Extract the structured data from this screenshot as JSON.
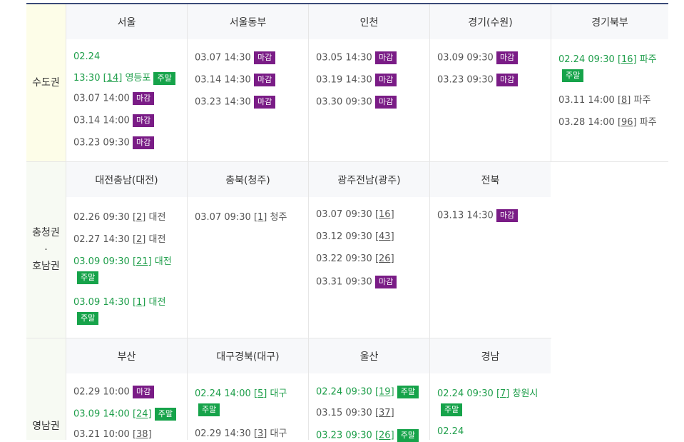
{
  "colors": {
    "closed_badge": "#7a1c86",
    "weekend_badge": "#16a34a",
    "green_text": "#1e9e4a",
    "top_line": "#3a4a78"
  },
  "regions": {
    "capital": {
      "label": "수도권",
      "cities": {
        "seoul": {
          "name": "서울"
        },
        "seoul_east": {
          "name": "서울동부"
        },
        "incheon": {
          "name": "인천"
        },
        "gyeonggi_suwon": {
          "name": "경기(수원)"
        },
        "gyeonggi_north": {
          "name": "경기북부"
        }
      }
    },
    "chungcheong_honam": {
      "label_top": "충청권",
      "label_dot": "·",
      "label_bottom": "호남권",
      "cities": {
        "daejeon": {
          "name": "대전충남(대전)"
        },
        "chungbuk": {
          "name": "충북(청주)"
        },
        "gwangju": {
          "name": "광주전남(광주)"
        },
        "jeonbuk": {
          "name": "전북"
        }
      }
    },
    "yeongnam": {
      "label": "영남권",
      "cities": {
        "busan": {
          "name": "부산"
        },
        "daegu": {
          "name": "대구경북(대구)"
        },
        "ulsan": {
          "name": "울산"
        },
        "gyeongnam": {
          "name": "경남"
        }
      }
    }
  },
  "badges": {
    "closed": "마감",
    "weekend": "주말"
  },
  "sessions": {
    "seoul": [
      {
        "date": "02.24"
      },
      {
        "time": "13:30",
        "num": "[14]",
        "place": "영등포"
      },
      {
        "text": "03.07 14:00"
      },
      {
        "text": "03.14 14:00"
      },
      {
        "text": "03.23 09:30"
      }
    ],
    "seoul_east": [
      {
        "text": "03.07 14:30"
      },
      {
        "text": "03.14 14:30"
      },
      {
        "text": "03.23 14:30"
      }
    ],
    "incheon": [
      {
        "text": "03.05 14:30"
      },
      {
        "text": "03.19 14:30"
      },
      {
        "text": "03.30 09:30"
      }
    ],
    "gyeonggi_suwon": [
      {
        "text": "03.09 09:30"
      },
      {
        "text": "03.23 09:30"
      }
    ],
    "gyeonggi_north": [
      {
        "text": "02.24 09:30",
        "num": "[16]",
        "place": "파주"
      },
      {
        "text": "03.11 14:00",
        "num": "[8]",
        "place": "파주"
      },
      {
        "text": "03.28 14:00",
        "num": "[96]",
        "place": "파주"
      }
    ],
    "daejeon": [
      {
        "text": "02.26 09:30",
        "num": "[2]",
        "place": "대전"
      },
      {
        "text": "02.27 14:30",
        "num": "[2]",
        "place": "대전"
      },
      {
        "text": "03.09 09:30",
        "num": "[21]",
        "place": "대전"
      },
      {
        "text": "03.09 14:30",
        "num": "[1]",
        "place": "대전"
      }
    ],
    "chungbuk": [
      {
        "text": "03.07 09:30",
        "num": "[1]",
        "place": "청주"
      }
    ],
    "gwangju": [
      {
        "text": "03.07 09:30",
        "num": "[16]"
      },
      {
        "text": "03.12 09:30",
        "num": "[43]"
      },
      {
        "text": "03.22 09:30",
        "num": "[26]"
      },
      {
        "text": "03.31 09:30"
      }
    ],
    "jeonbuk": [
      {
        "text": "03.13 14:30"
      }
    ],
    "busan": [
      {
        "text": "02.29 10:00"
      },
      {
        "text": "03.09 14:00",
        "num": "[24]"
      },
      {
        "text": "03.21 10:00",
        "num": "[38]"
      }
    ],
    "daegu": [
      {
        "text": "02.24 14:00",
        "num": "[5]",
        "place": "대구"
      },
      {
        "text": "02.29 14:30",
        "num": "[3]",
        "place": "대구"
      }
    ],
    "ulsan": [
      {
        "text": "02.24 09:30",
        "num": "[19]"
      },
      {
        "text": "03.15 09:30",
        "num": "[37]"
      },
      {
        "text": "03.23 09:30",
        "num": "[26]"
      }
    ],
    "gyeongnam": [
      {
        "text": "02.24 09:30",
        "num": "[7]",
        "place": "창원시"
      },
      {
        "date": "02.24"
      }
    ]
  }
}
